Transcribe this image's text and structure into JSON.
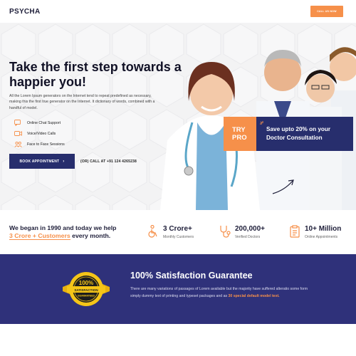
{
  "header": {
    "logo": "PSYCHA",
    "call_button": "CALL US NOW"
  },
  "hero": {
    "title": "Take the first step towards a happier you!",
    "description": "All the Lorem Ipsum generators on the Internet tend to repeat predefined as necessary, making this the first true generator on the Internet. It dictionary of words, combined with a handful of model.",
    "features": [
      {
        "label": "Online Chat Support",
        "icon": "chat-icon"
      },
      {
        "label": "Voice/Video Calls",
        "icon": "video-call-icon"
      },
      {
        "label": "Face to Face Sessions",
        "icon": "people-icon"
      }
    ],
    "book_button": "BOOK APPOINTMENT",
    "or_call": "(OR)  CALL AT +91 124 4265238"
  },
  "promo": {
    "try_line1": "TRY",
    "try_line2": "PRO",
    "save_line1": "Save upto 20% on your",
    "save_line2": "Doctor Consultation"
  },
  "stats": {
    "lead_line1": "We began in 1990 and today we help",
    "lead_highlight": "3 Crore + Customers",
    "lead_tail": " every month.",
    "items": [
      {
        "value": "3 Crore+",
        "label": "Monthly Customers",
        "icon": "wheelchair-icon"
      },
      {
        "value": "200,000+",
        "label": "Verified Doctors",
        "icon": "stethoscope-icon"
      },
      {
        "value": "10+ Million",
        "label": "Online Appointments",
        "icon": "clipboard-icon"
      }
    ]
  },
  "guarantee": {
    "title": "100% Satisfaction Guarantee",
    "text_main": "There are many variations of passages of Lorem available but the majority have suffered alteratio some form simply dummy text of printing and typeset packages and as ",
    "text_highlight": "30 special default model text.",
    "badge_big": "100%",
    "badge_mid": "SATISFACTION",
    "badge_small": "GUARANTEED"
  },
  "colors": {
    "accent": "#f6904a",
    "navy": "#272e6d",
    "band": "#2f317a"
  }
}
